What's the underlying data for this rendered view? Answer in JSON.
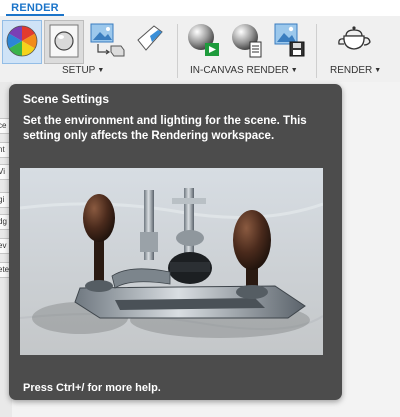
{
  "ribbon": {
    "active_tab": "RENDER",
    "groups": {
      "setup": "SETUP",
      "in_canvas_render": "IN-CANVAS RENDER",
      "render": "RENDER"
    },
    "caret": "▼",
    "accent_color": "#1b74c9"
  },
  "browser_strip": [
    "ce",
    "nt",
    "Vi",
    "gi",
    "dg",
    "ev",
    "ete"
  ],
  "tooltip": {
    "title": "Scene Settings",
    "description": "Set the environment and lighting for the scene. This setting only affects the Rendering workspace.",
    "help": "Press Ctrl+/ for more help.",
    "background": "#4c4c4c"
  }
}
